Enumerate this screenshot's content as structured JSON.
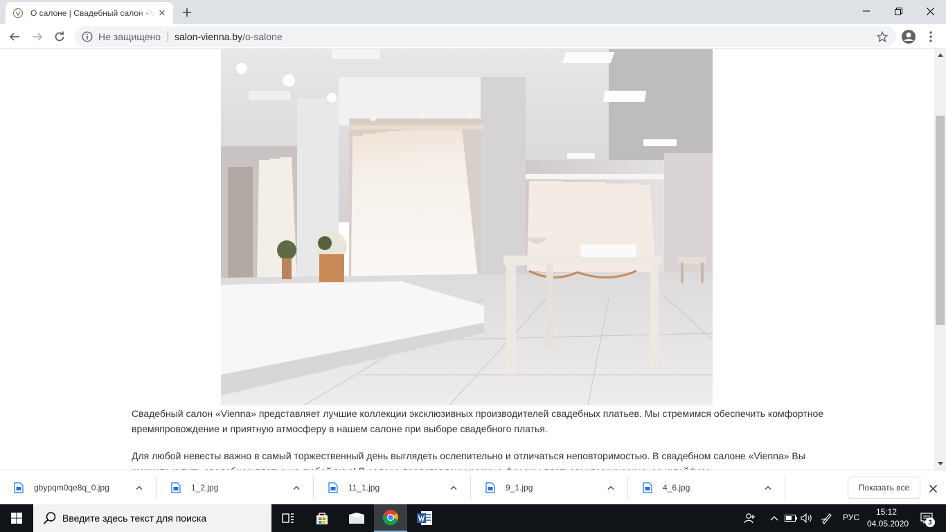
{
  "browser": {
    "tab_title": "О салоне | Свадебный салон «Vienna»",
    "security_label": "Не защищено",
    "url_host": "salon-vienna.by",
    "url_path": "/o-salone"
  },
  "page": {
    "image_alt": "Интерьер свадебного салона Vienna",
    "paragraph_1": "Свадебный салон «Vienna» представляет лучшие  коллекции эксклюзивных  производителей свадебных платьев. Мы стремимся обеспечить комфортное времяпровождение и приятную атмосферу в нашем салоне при выборе свадебного платья.",
    "paragraph_2": "Для любой невесты важно в самый торжественный день выглядеть ослепительно и отличаться неповторимостью. В свадебном салоне «Vienna» Вы сможете купить свадебное платье на любой вкус! В салоне представлены разные фасоны платьев: классические, со шлейфом"
  },
  "downloads": {
    "items": [
      {
        "name": "gbypqm0qe8q_0.jpg"
      },
      {
        "name": "1_2.jpg"
      },
      {
        "name": "11_1.jpg"
      },
      {
        "name": "9_1.jpg"
      },
      {
        "name": "4_6.jpg"
      }
    ],
    "show_all_label": "Показать все"
  },
  "taskbar": {
    "search_placeholder": "Введите здесь текст для поиска",
    "language": "РУС",
    "time": "15:12",
    "date": "04.05.2020",
    "notification_count": "3"
  },
  "colors": {
    "chrome_frame": "#dee1e6",
    "omnibox_bg": "#f1f3f4",
    "taskbar_bg": "#101418",
    "text_main": "#333333"
  }
}
